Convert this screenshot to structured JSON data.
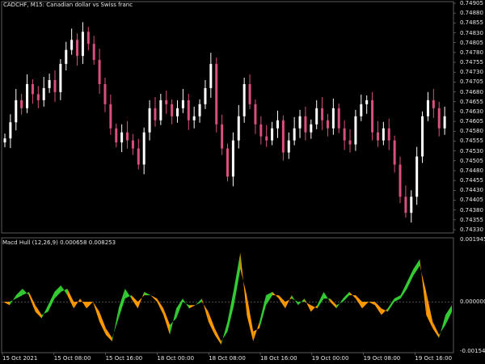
{
  "main": {
    "title": "CADCHF, M15:  Canadian dollar vs Swiss franc",
    "price_labels": [
      "0.74905",
      "0.74880",
      "0.74855",
      "0.74830",
      "0.74805",
      "0.74780",
      "0.74755",
      "0.74730",
      "0.74705",
      "0.74680",
      "0.74655",
      "0.74630",
      "0.74605",
      "0.74580",
      "0.74555",
      "0.74530",
      "0.74505",
      "0.74480",
      "0.74455",
      "0.74430",
      "0.74405",
      "0.74380",
      "0.74355",
      "0.74330"
    ],
    "time_labels": [
      "15 Oct 2021",
      "15 Oct 08:00",
      "15 Oct 16:00",
      "18 Oct 00:00",
      "18 Oct 08:00",
      "18 Oct 16:00",
      "19 Oct 00:00",
      "19 Oct 08:00",
      "19 Oct 16:00"
    ],
    "indicator": {
      "name": "Macd Hull (12,26,9) 0.000658 0.008253",
      "scale_labels": [
        "0.001945",
        "0.000000",
        "-0.001545"
      ]
    }
  },
  "colors": {
    "background": "#000000",
    "bull": "#ffffff",
    "bear": "#d94f7f",
    "band_up": "#33cc33",
    "band_down": "#ff9900",
    "grid": "#808080"
  },
  "chart_data": [
    {
      "type": "line",
      "series": [
        {
          "values": [
            0.74565,
            0.74605,
            0.7466,
            0.7464,
            0.747,
            0.74675,
            0.7466,
            0.7469,
            0.7471,
            0.7468,
            0.7475,
            0.74785,
            0.7481,
            0.7477,
            0.7483,
            0.748,
            0.7476,
            0.747,
            0.7465,
            0.7459,
            0.74555,
            0.7458,
            0.7456,
            0.7454,
            0.745,
            0.7458,
            0.7464,
            0.7461,
            0.7466,
            0.7465,
            0.7462,
            0.7464,
            0.7466,
            0.7461,
            0.7462,
            0.7465,
            0.7469,
            0.7475,
            0.746,
            0.7454,
            0.7447,
            0.7456,
            0.7462,
            0.747,
            0.7465,
            0.746,
            0.7457,
            0.7456,
            0.7459,
            0.7461,
            0.7453,
            0.7456,
            0.7459,
            0.7462,
            0.7458,
            0.746,
            0.7464,
            0.7461,
            0.7459,
            0.7464,
            0.7459,
            0.7456,
            0.7455,
            0.7462,
            0.7465,
            0.7466,
            0.7458,
            0.7456,
            0.7459,
            0.7456,
            0.745,
            0.7442,
            0.7438,
            0.7442,
            0.7452,
            0.7462,
            0.7466,
            0.7464,
            0.7459,
            0.7462
          ]
        }
      ],
      "ylim": [
        0.7433,
        0.74905
      ]
    },
    {
      "type": "area",
      "series": [
        {
          "values": [
            0.0,
            -0.0001,
            0.0002,
            0.0004,
            0.0002,
            -0.0003,
            -0.0005,
            -0.0001,
            0.0003,
            0.0005,
            0.0002,
            -0.0002,
            0.0001,
            -0.0002,
            0.0,
            -0.0006,
            -0.001,
            -0.0012,
            -0.0002,
            0.0004,
            0.0001,
            -0.0002,
            0.0003,
            0.0002,
            0.0,
            -0.0004,
            -0.001,
            -0.0002,
            0.0001,
            -0.0002,
            -0.0001,
            0.0001,
            -0.0006,
            -0.001,
            -0.0013,
            -0.0006,
            0.0004,
            0.0015,
            -0.0004,
            -0.0012,
            -0.0006,
            0.0002,
            0.0003,
            0.0001,
            -0.0002,
            0.0002,
            -0.0001,
            0.0001,
            -0.0003,
            -0.0001,
            0.0003,
            0.0,
            -0.0002,
            0.0001,
            0.0003,
            0.0001,
            -0.0002,
            0.0,
            -0.0001,
            -0.0004,
            -0.0002,
            0.0001,
            0.0002,
            0.0006,
            0.001,
            0.0013,
            -0.0004,
            -0.0008,
            -0.0011,
            -0.0004,
            -0.0001
          ]
        },
        {
          "values": [
            0.0,
            0.0,
            0.0001,
            0.0002,
            0.0003,
            -0.0001,
            -0.0004,
            -0.0003,
            0.0001,
            0.0003,
            0.0004,
            0.0,
            0.0,
            0.0,
            0.0,
            -0.0003,
            -0.0008,
            -0.0011,
            -0.0005,
            0.0001,
            0.0002,
            0.0,
            0.0002,
            0.0002,
            0.0001,
            -0.0002,
            -0.0007,
            -0.0005,
            0.0,
            -0.0001,
            -0.0001,
            0.0,
            -0.0003,
            -0.0008,
            -0.0012,
            -0.0009,
            -0.0001,
            0.001,
            0.0002,
            -0.0009,
            -0.0008,
            -0.0001,
            0.0002,
            0.0002,
            0.0,
            0.0001,
            0.0,
            0.0,
            -0.0001,
            -0.0002,
            0.0001,
            0.0001,
            -0.0001,
            0.0,
            0.0002,
            0.0002,
            0.0,
            0.0,
            0.0,
            -0.0002,
            -0.0003,
            0.0,
            0.0001,
            0.0004,
            0.0008,
            0.0011,
            0.0003,
            -0.0006,
            -0.001,
            -0.0007,
            -0.0003
          ]
        }
      ],
      "ylim": [
        -0.001545,
        0.001945
      ]
    }
  ]
}
